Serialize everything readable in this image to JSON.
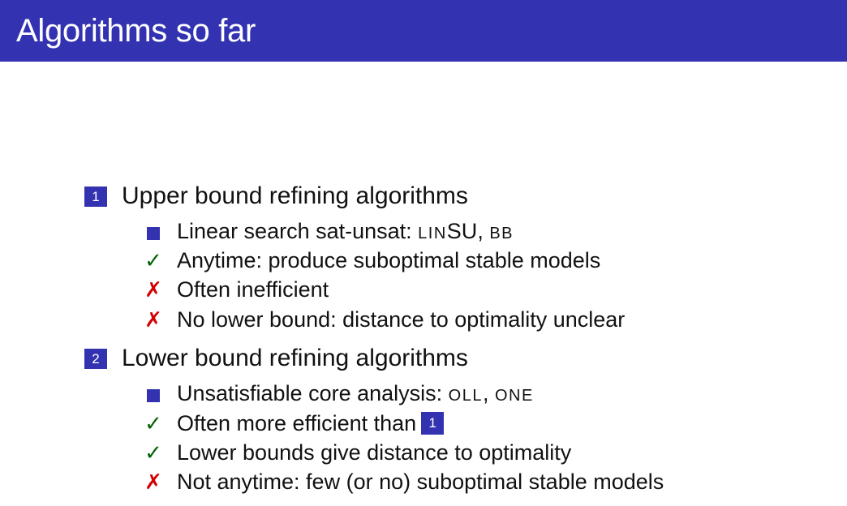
{
  "title": "Algorithms so far",
  "colors": {
    "accent": "#3333b2",
    "check": "#006400",
    "cross": "#d40000"
  },
  "sections": [
    {
      "number": "1",
      "heading": "Upper bound refining algorithms",
      "items": [
        {
          "marker": "square",
          "text": "Linear search sat-unsat: ",
          "sc1": "LIN",
          "mid": "SU",
          "sep": ", ",
          "sc2": "BB"
        },
        {
          "marker": "check",
          "text": "Anytime: produce suboptimal stable models"
        },
        {
          "marker": "cross",
          "text": "Often inefficient"
        },
        {
          "marker": "cross",
          "text": "No lower bound: distance to optimality unclear"
        }
      ]
    },
    {
      "number": "2",
      "heading": "Lower bound refining algorithms",
      "items": [
        {
          "marker": "square",
          "text": "Unsatisfiable core analysis: ",
          "sc1": "OLL",
          "sep": ", ",
          "sc2": "ONE"
        },
        {
          "marker": "check",
          "text": "Often more efficient than",
          "ref": "1"
        },
        {
          "marker": "check",
          "text": "Lower bounds give distance to optimality"
        },
        {
          "marker": "cross",
          "text": "Not anytime: few (or no) suboptimal stable models"
        }
      ]
    }
  ],
  "glyphs": {
    "check": "✓",
    "cross": "✗"
  }
}
